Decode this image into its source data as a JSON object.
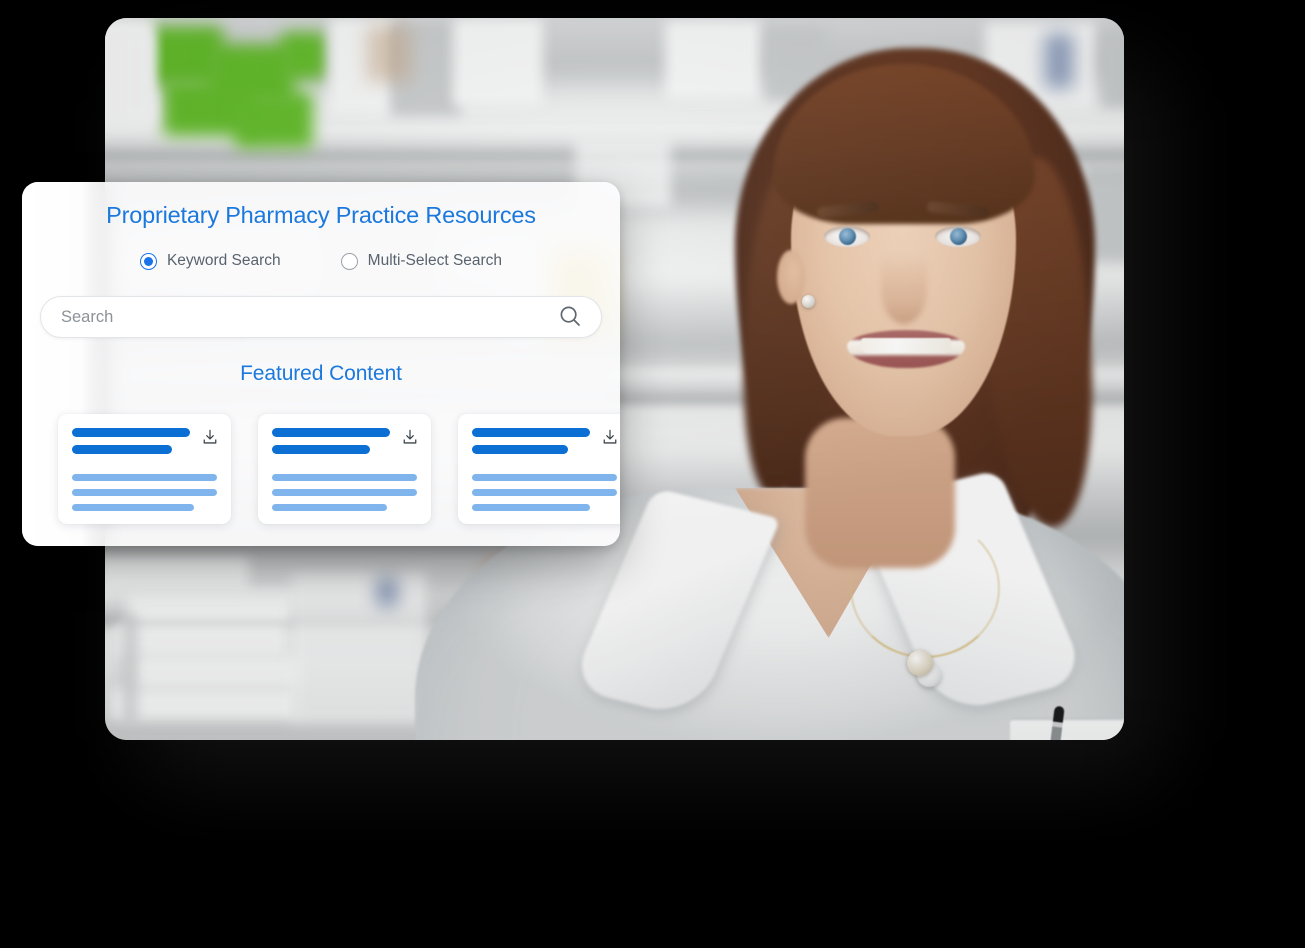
{
  "background": {
    "color": "#000000"
  },
  "hero": {
    "photo_alt": "Smiling pharmacist in white lab coat standing in front of blurred pharmacy shelves",
    "accent_blue": "#1b78dd",
    "bar_dark_blue": "#0b6fd4",
    "bar_light_blue": "#7fb4ec"
  },
  "overlay": {
    "title": "Proprietary Pharmacy Practice Resources",
    "search_modes": [
      {
        "label": "Keyword Search",
        "selected": true
      },
      {
        "label": "Multi-Select Search",
        "selected": false
      }
    ],
    "search": {
      "value": "",
      "placeholder": "Search",
      "icon": "search-icon"
    },
    "featured": {
      "heading": "Featured Content",
      "cards": [
        {
          "download_icon": "download-icon",
          "title_bars": 2,
          "body_bars": 3
        },
        {
          "download_icon": "download-icon",
          "title_bars": 2,
          "body_bars": 3
        },
        {
          "download_icon": "download-icon",
          "title_bars": 2,
          "body_bars": 3
        }
      ]
    }
  }
}
